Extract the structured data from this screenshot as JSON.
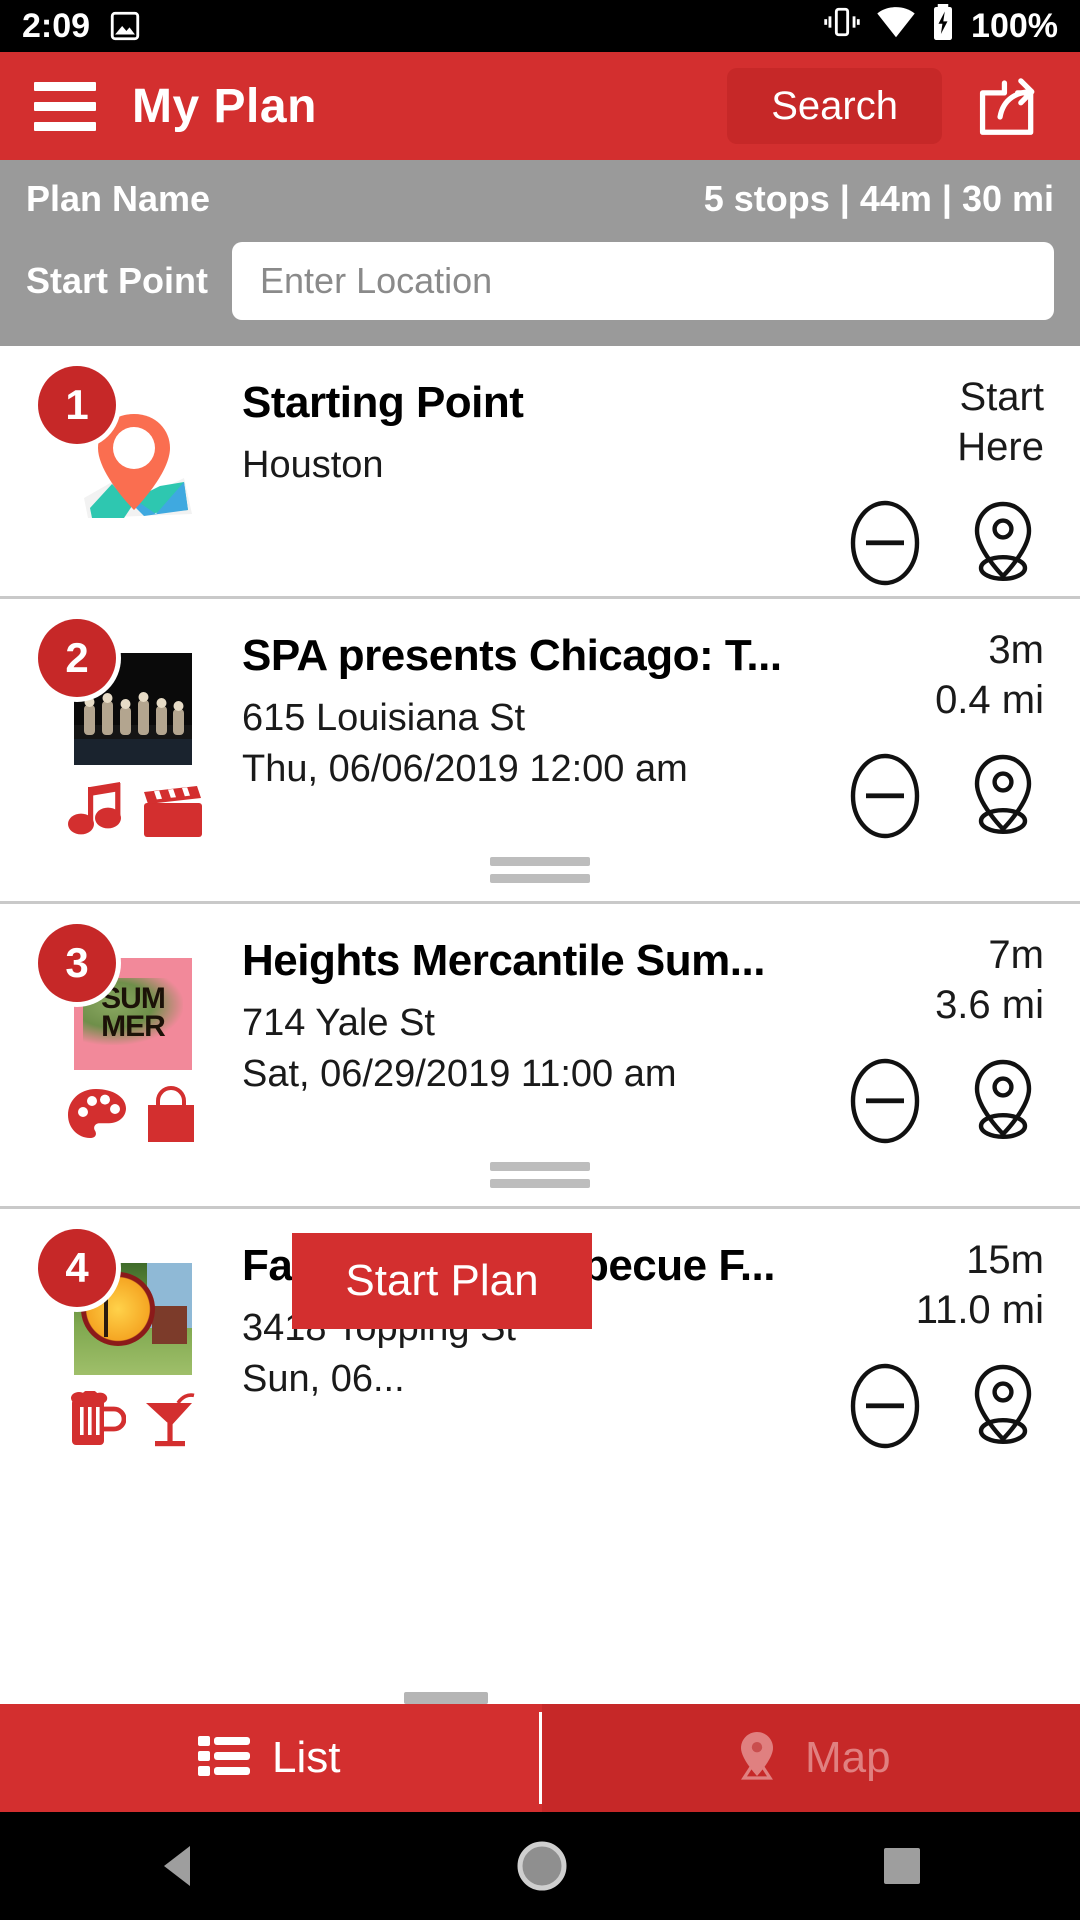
{
  "statusbar": {
    "time": "2:09",
    "battery": "100%",
    "icons": [
      "image-icon",
      "vibrate-icon",
      "wifi-icon",
      "battery-charging-icon"
    ]
  },
  "appbar": {
    "menu_icon": "hamburger-menu-icon",
    "title": "My Plan",
    "search_label": "Search",
    "share_icon": "share-icon"
  },
  "planbar": {
    "plan_name_label": "Plan Name",
    "stats": "5 stops  |  44m  |  30 mi",
    "stops_count": "5 stops",
    "duration": "44m",
    "distance": "30 mi",
    "start_point_label": "Start Point",
    "location_value": "",
    "location_placeholder": "Enter Location"
  },
  "stops": [
    {
      "number": "1",
      "title": "Starting Point",
      "address": "Houston",
      "date": "",
      "eta_line1": "Start",
      "eta_line2": "Here",
      "thumb_kind": "map-pin-illustration",
      "categories": [],
      "remove_icon": "minus-circle-icon",
      "locate_icon": "map-pin-icon"
    },
    {
      "number": "2",
      "title": "SPA presents Chicago: T...",
      "address": "615 Louisiana St",
      "date": "Thu, 06/06/2019 12:00 am",
      "eta_line1": "3m",
      "eta_line2": "0.4 mi",
      "thumb_kind": "stage-performance-photo",
      "categories": [
        "music-note-icon",
        "clapperboard-icon"
      ],
      "remove_icon": "minus-circle-icon",
      "locate_icon": "map-pin-icon"
    },
    {
      "number": "3",
      "title": "Heights Mercantile Sum...",
      "address": "714 Yale St",
      "date": "Sat, 06/29/2019 11:00 am",
      "eta_line1": "7m",
      "eta_line2": "3.6 mi",
      "thumb_kind": "summer-poster",
      "thumb_text_line1": "SUM",
      "thumb_text_line2": "MER",
      "categories": [
        "art-palette-icon",
        "shopping-bag-icon"
      ],
      "remove_icon": "minus-circle-icon",
      "locate_icon": "map-pin-icon"
    },
    {
      "number": "4",
      "title": "Father's Day Barbecue F...",
      "address": "3418 Topping St",
      "date": "Sun, 06...",
      "eta_line1": "15m",
      "eta_line2": "11.0 mi",
      "thumb_kind": "barbecue-farm-photo",
      "categories": [
        "beer-mug-icon",
        "cocktail-glass-icon"
      ],
      "remove_icon": "minus-circle-icon",
      "locate_icon": "map-pin-icon"
    }
  ],
  "start_plan": {
    "label": "Start Plan"
  },
  "tabs": [
    {
      "label": "List",
      "icon": "list-icon",
      "active": true
    },
    {
      "label": "Map",
      "icon": "map-pin-icon",
      "active": false
    }
  ],
  "navbar": {
    "back_icon": "back-triangle-icon",
    "home_icon": "home-circle-icon",
    "recents_icon": "recents-square-icon"
  },
  "colors": {
    "brand_red": "#d32f2f",
    "dark_red": "#c62828",
    "grey_bar": "#9a9a9a",
    "badge_red": "#c62828",
    "pin_orange": "#fa6e50"
  }
}
